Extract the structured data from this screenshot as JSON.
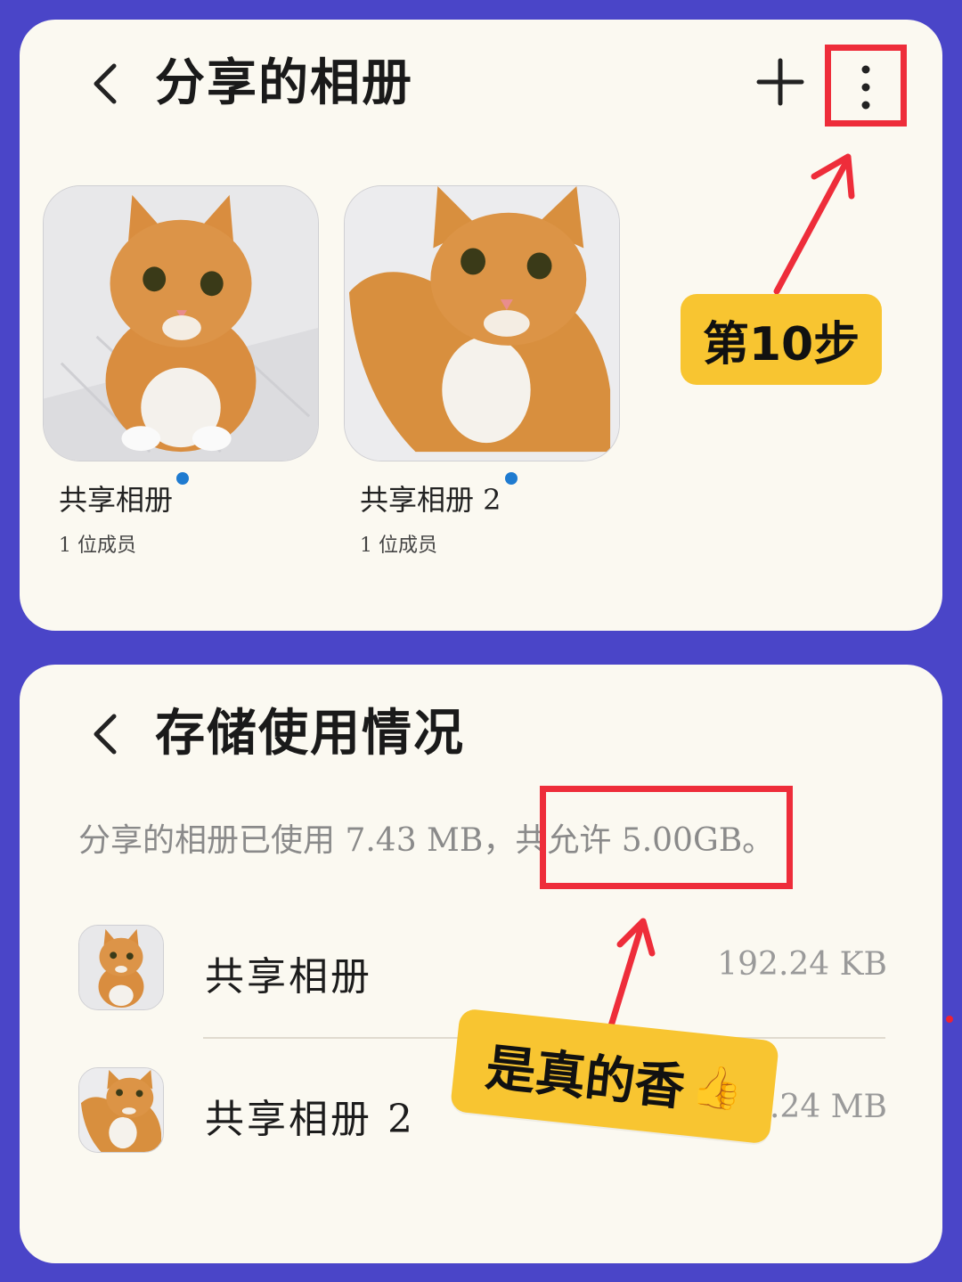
{
  "colors": {
    "page_background": "#4a45c8",
    "card_background": "#fbf9f1",
    "highlight_red": "#ee2d3a",
    "badge_yellow": "#f8c531",
    "new_dot_blue": "#1f7bd0"
  },
  "shared_albums_screen": {
    "title": "分享的相册",
    "back_icon": "chevron-left-icon",
    "add_icon": "plus-icon",
    "more_icon": "vertical-dots-icon",
    "albums": [
      {
        "name": "共享相册",
        "members": "1 位成员",
        "has_new": true,
        "thumbnail": "orange-tabby-cat-photo"
      },
      {
        "name": "共享相册 2",
        "members": "1 位成员",
        "has_new": true,
        "thumbnail": "orange-tabby-cat-cutout-photo"
      }
    ]
  },
  "annotations": {
    "step_badge": "第10步",
    "praise_badge": "是真的香",
    "praise_emoji": "👍"
  },
  "storage_screen": {
    "title": "存储使用情况",
    "back_icon": "chevron-left-icon",
    "usage_summary": "分享的相册已使用 7.43 MB，共允许 5.00GB。",
    "items": [
      {
        "name": "共享相册",
        "size": "192.24 KB"
      },
      {
        "name": "共享相册 2",
        "size": "7.24 MB"
      }
    ]
  }
}
